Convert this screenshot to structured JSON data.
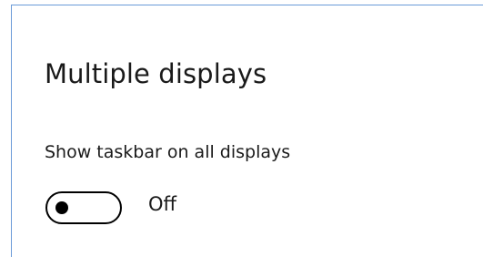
{
  "section": {
    "title": "Multiple displays"
  },
  "setting": {
    "label": "Show taskbar on all displays",
    "toggle_state": "Off",
    "toggle_on": false
  },
  "colors": {
    "border": "#6b9bd8",
    "text": "#1a1a1a",
    "toggle": "#000000"
  }
}
